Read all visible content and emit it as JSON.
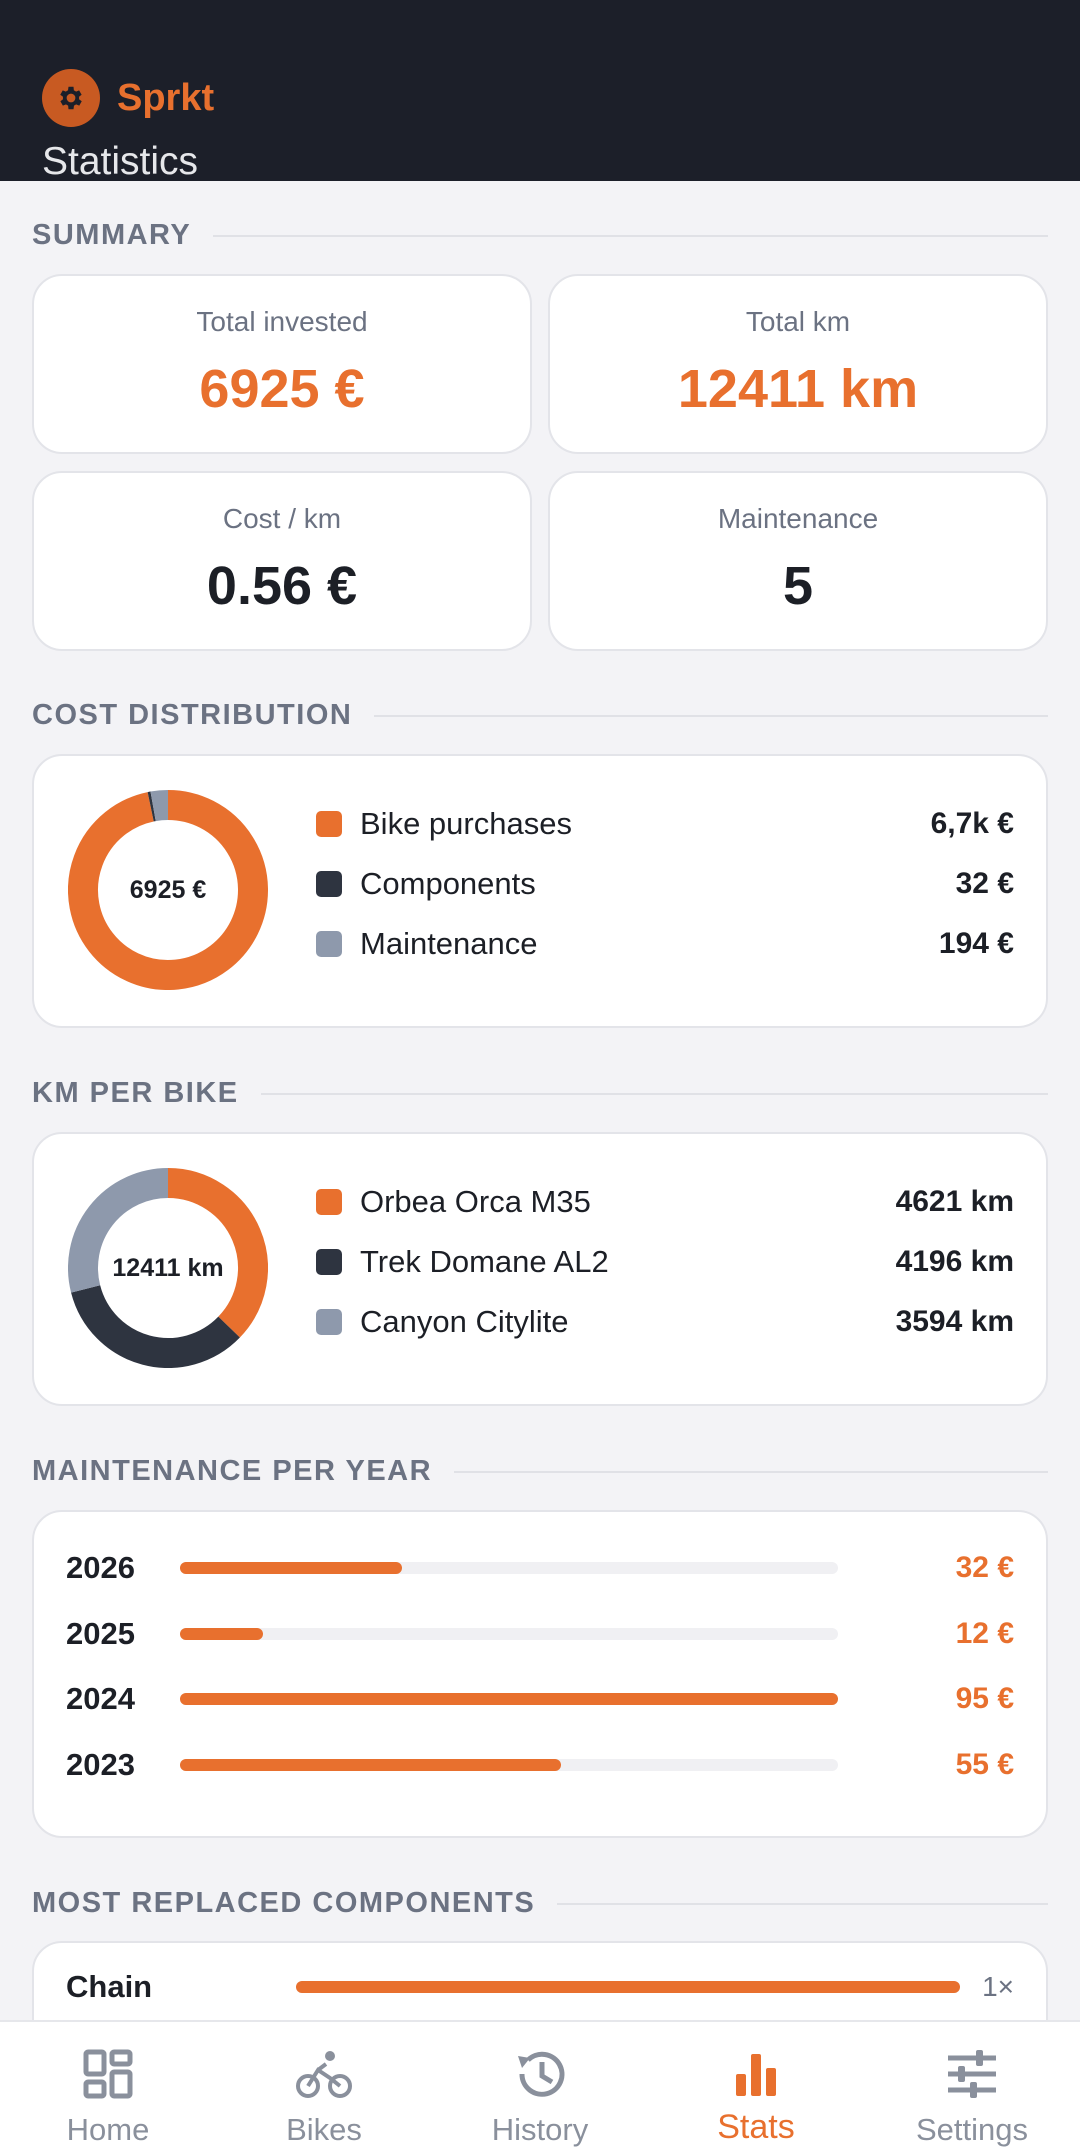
{
  "app": {
    "name": "Sprkt",
    "page_title": "Statistics"
  },
  "colors": {
    "accent": "#e8702e",
    "dark": "#2e3440",
    "gray": "#8e99ac"
  },
  "summary": {
    "heading": "SUMMARY",
    "total_invested": {
      "label": "Total invested",
      "value": "6925 €"
    },
    "total_km": {
      "label": "Total km",
      "value": "12411 km"
    },
    "cost_per_km": {
      "label": "Cost / km",
      "value": "0.56 €"
    },
    "maintenance": {
      "label": "Maintenance",
      "value": "5"
    }
  },
  "cost_distribution": {
    "heading": "COST DISTRIBUTION",
    "center": "6925 €",
    "items": [
      {
        "label": "Bike purchases",
        "value": "6,7k €",
        "amount": 6699,
        "color": "#e8702e"
      },
      {
        "label": "Components",
        "value": "32 €",
        "amount": 32,
        "color": "#2e3440"
      },
      {
        "label": "Maintenance",
        "value": "194 €",
        "amount": 194,
        "color": "#8e99ac"
      }
    ]
  },
  "km_per_bike": {
    "heading": "KM PER BIKE",
    "center": "12411 km",
    "items": [
      {
        "label": "Orbea Orca M35",
        "value": "4621 km",
        "amount": 4621,
        "color": "#e8702e"
      },
      {
        "label": "Trek Domane AL2",
        "value": "4196 km",
        "amount": 4196,
        "color": "#2e3440"
      },
      {
        "label": "Canyon Citylite",
        "value": "3594 km",
        "amount": 3594,
        "color": "#8e99ac"
      }
    ]
  },
  "maintenance_per_year": {
    "heading": "MAINTENANCE PER YEAR",
    "max": 95,
    "rows": [
      {
        "year": "2026",
        "label": "32 €",
        "amount": 32
      },
      {
        "year": "2025",
        "label": "12 €",
        "amount": 12
      },
      {
        "year": "2024",
        "label": "95 €",
        "amount": 95
      },
      {
        "year": "2023",
        "label": "55 €",
        "amount": 55
      }
    ]
  },
  "most_replaced": {
    "heading": "MOST REPLACED COMPONENTS",
    "rows": [
      {
        "name": "Chain",
        "count": "1×",
        "fraction": 1.0
      }
    ]
  },
  "nav": {
    "items": [
      {
        "label": "Home",
        "icon": "dashboard-icon"
      },
      {
        "label": "Bikes",
        "icon": "bike-icon"
      },
      {
        "label": "History",
        "icon": "history-icon"
      },
      {
        "label": "Stats",
        "icon": "bar-chart-icon",
        "active": true
      },
      {
        "label": "Settings",
        "icon": "sliders-icon"
      }
    ]
  }
}
